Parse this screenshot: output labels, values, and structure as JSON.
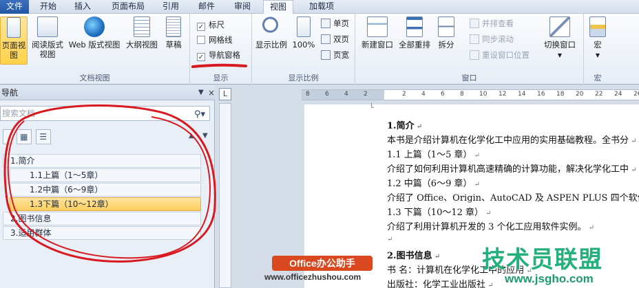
{
  "tabs": [
    "文件",
    "开始",
    "插入",
    "页面布局",
    "引用",
    "邮件",
    "审阅",
    "视图",
    "加载项"
  ],
  "active_tab": "视图",
  "ribbon": {
    "doc_view": {
      "label": "文档视图",
      "buttons": [
        "页面视图",
        "阅读版式视图",
        "Web 版式视图",
        "大纲视图",
        "草稿"
      ],
      "read_line1": "阅读版式",
      "read_line2": "视图"
    },
    "show": {
      "label": "显示",
      "items": [
        {
          "label": "标尺",
          "checked": true
        },
        {
          "label": "网格线",
          "checked": false
        },
        {
          "label": "导航窗格",
          "checked": true
        }
      ]
    },
    "zoom": {
      "label": "显示比例",
      "zoom_label": "显示比例",
      "pct_label": "100%",
      "small": [
        "单页",
        "双页",
        "页宽"
      ]
    },
    "window": {
      "label": "窗口",
      "new_window": "新建窗口",
      "arrange_all": "全部重排",
      "split": "拆分",
      "side_by_side": "并排查看",
      "sync_scroll": "同步滚动",
      "reset_pos": "重设窗口位置",
      "switch": "切换窗口"
    },
    "macro": {
      "label": "宏",
      "button": "宏"
    }
  },
  "nav": {
    "title": "导航",
    "search_placeholder": "搜索文档",
    "tree": [
      {
        "label": "1.简介",
        "level": 1,
        "selected": false
      },
      {
        "label": "1.1上篇（1～5章）",
        "level": 2,
        "selected": false
      },
      {
        "label": "1.2中篇（6～9章）",
        "level": 2,
        "selected": false
      },
      {
        "label": "1.3下篇（10～12章）",
        "level": 2,
        "selected": true
      },
      {
        "label": "2.图书信息",
        "level": 1,
        "selected": false
      },
      {
        "label": "3.适用群体",
        "level": 1,
        "selected": false
      }
    ]
  },
  "ruler_numbers": [
    "8",
    "6",
    "4",
    "2",
    "",
    "2",
    "4",
    "6",
    "8",
    "10",
    "12",
    "14",
    "16",
    "18",
    "20",
    "22",
    "24",
    "26"
  ],
  "ruler_corner": "L",
  "document": {
    "lines": [
      {
        "text": "1.简介",
        "bold": true
      },
      {
        "text": "本书是介绍计算机在化学化工中应用的实用基础教程。全书分",
        "bold": false
      },
      {
        "text": "1.1 上篇（1～5 章）",
        "bold": false
      },
      {
        "text": "介绍了如何利用计算机高速精确的计算功能，解决化学化工中",
        "bold": false
      },
      {
        "text": "1.2 中篇（6～9 章）",
        "bold": false
      },
      {
        "text": "介绍了 Office、Origin、AutoCAD 及 ASPEN PLUS 四个软件",
        "bold": false
      },
      {
        "text": "1.3 下篇（10～12 章）",
        "bold": false
      },
      {
        "text": "介绍了利用计算机开发的 3 个化工应用软件实例。",
        "bold": false
      },
      {
        "text": "",
        "bold": false
      },
      {
        "text": "2.图书信息",
        "bold": true
      },
      {
        "text": "书  名：计算机在化学化工中的应用",
        "bold": false
      },
      {
        "text": "出版社：化学工业出版社",
        "bold": false
      }
    ]
  },
  "watermarks": {
    "badge": "Office办公助手",
    "url": "www.officezhushou.com",
    "brand": "技术员联盟",
    "site": "www.jsgho.com"
  },
  "colors": {
    "file_tab": "#2456a6",
    "selected_item": "#fbcf5f",
    "annotation_red": "#d8191f",
    "brand_green": "#23b07b"
  }
}
